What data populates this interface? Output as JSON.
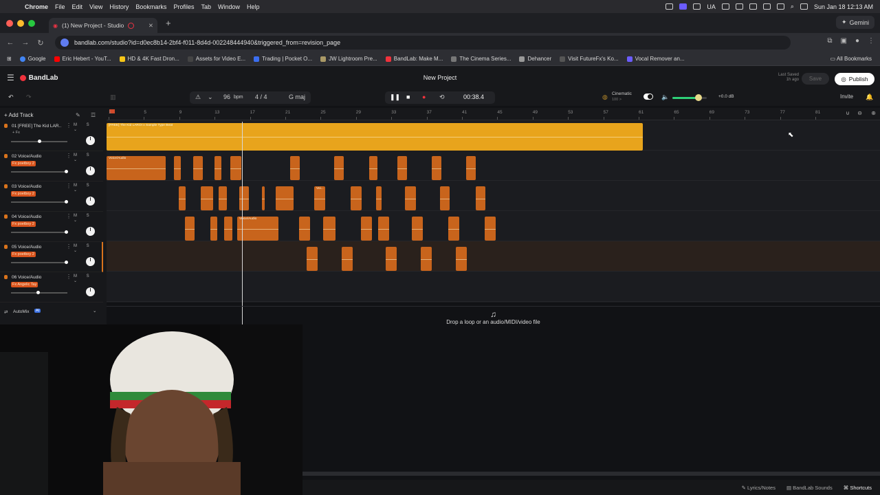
{
  "mac_menubar": {
    "app": "Chrome",
    "items": [
      "File",
      "Edit",
      "View",
      "History",
      "Bookmarks",
      "Profiles",
      "Tab",
      "Window",
      "Help"
    ],
    "ua": "UA",
    "datetime": "Sun Jan 18  12:13 AM"
  },
  "browser": {
    "tab_title": "(1) New Project - Studio",
    "url": "bandlab.com/studio?id=d0ec8b14-2bf4-f011-8d4d-002248444940&triggered_from=revision_page",
    "gemini": "Gemini",
    "bookmarks": [
      "Google",
      "Eric Hebert - YouT...",
      "HD & 4K Fast Dron...",
      "Assets for Video E...",
      "Trading | Pocket O...",
      "JW Lightroom Pre...",
      "BandLab: Make M...",
      "The Cinema Series...",
      "Dehancer",
      "Visit FutureFx's Ko...",
      "Vocal Remover an..."
    ],
    "all_bookmarks": "All Bookmarks"
  },
  "bandlab": {
    "logo": "BandLab",
    "project_title": "New Project",
    "last_saved_label": "Last Saved",
    "last_saved_value": "1h ago",
    "save": "Save",
    "publish": "Publish",
    "invite": "Invite",
    "bpm": "96",
    "bpm_unit": "bpm",
    "time_sig": "4 / 4",
    "key": "G maj",
    "time": "00:38.4",
    "preset": "Cinematic",
    "preset_sub": "100 >",
    "volume_db": "+0.0 dB",
    "volume_level": 0.75,
    "add_track": "Add Track",
    "ruler_marks": [
      "1",
      "5",
      "9",
      "13",
      "17",
      "21",
      "25",
      "29",
      "33",
      "37",
      "41",
      "45",
      "49",
      "53",
      "57",
      "61",
      "65",
      "69",
      "73",
      "77",
      "81"
    ],
    "tracks": [
      {
        "num": "01",
        "name": "[FREE] The Kid LAR...",
        "fx": "+ Fx",
        "fx_plain": true,
        "volume": 0.5
      },
      {
        "num": "02",
        "name": "Voice/Audio",
        "fx": "Fx poetboy 2",
        "fx_plain": false,
        "volume": 0.98
      },
      {
        "num": "03",
        "name": "Voice/Audio",
        "fx": "Fx poetboy 2",
        "fx_plain": false,
        "volume": 0.98
      },
      {
        "num": "04",
        "name": "Voice/Audio",
        "fx": "Fx poetboy 2",
        "fx_plain": false,
        "volume": 0.98
      },
      {
        "num": "05",
        "name": "Voice/Audio",
        "fx": "Fx poetboy 2",
        "fx_plain": false,
        "volume": 0.98
      },
      {
        "num": "06",
        "name": "Voice/Audio",
        "fx": "Fx Angelic Tay",
        "fx_plain": false,
        "volume": 0.48
      }
    ],
    "clip_beat": "[FREE] The Kid LAROI x Sample Type Beat",
    "clip_voice": "Voice/Audio",
    "clip_voice_short": "Voi...",
    "automix": "AutoMix",
    "automix_badge": "AI",
    "drop_text": "Drop a loop or an audio/MIDI/video file",
    "footer": {
      "lyrics": "Lyrics/Notes",
      "sounds": "BandLab Sounds",
      "shortcuts": "Shortcuts"
    }
  },
  "colors": {
    "beat": "#e8a41c",
    "voice": "#c8641c",
    "accent": "#f0323c"
  }
}
